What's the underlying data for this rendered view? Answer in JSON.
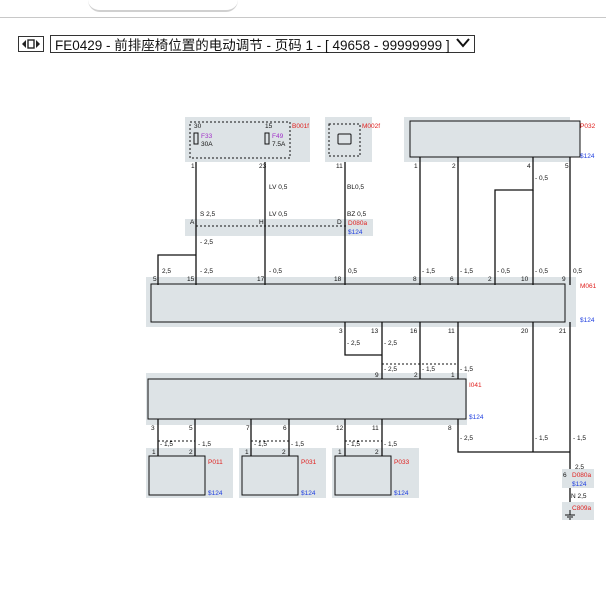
{
  "header": {
    "title": "FE0429 - 前排座椅位置的电动调节 - 页码 1 - [ 49658 - 99999999 ]",
    "icon": "fit-view-icon",
    "dropdown_icon": "chevron-down-icon"
  },
  "colors": {
    "box_fill": "#dde3e6",
    "component_red": "#e0201e",
    "signal_blue": "#1f3fe0",
    "fuse_purple": "#a030c8",
    "wire": "#111111"
  },
  "components": {
    "b001f": {
      "name": "B001f",
      "fuse1_pin": "30",
      "fuse1_id": "F33",
      "fuse1_rating": "30A",
      "fuse2_pin": "15",
      "fuse2_id": "F49",
      "fuse2_rating": "7.5A",
      "pin1": "1",
      "pin2": "23"
    },
    "m002f": {
      "name": "M002f",
      "pin": "11"
    },
    "p032": {
      "name": "P032",
      "ref": "$124",
      "pins": [
        "1",
        "2",
        "4",
        "5"
      ]
    },
    "d080a": {
      "name": "D080a",
      "ref": "$124",
      "pins": [
        "A",
        "H",
        "D"
      ]
    },
    "m061": {
      "name": "M061",
      "ref": "$124",
      "top_pins": [
        "5",
        "15",
        "17",
        "18",
        "8",
        "6",
        "2",
        "10",
        "9"
      ],
      "bottom_pins": [
        "3",
        "13",
        "16",
        "11",
        "20",
        "21"
      ]
    },
    "i041": {
      "name": "I041",
      "ref": "$124",
      "top_pins": [
        "9",
        "2",
        "1"
      ],
      "bottom_pins": [
        "3",
        "5",
        "7",
        "6",
        "12",
        "11",
        "8"
      ]
    },
    "p011": {
      "name": "P011",
      "ref": "$124",
      "pins": [
        "1",
        "2"
      ]
    },
    "p031": {
      "name": "P031",
      "ref": "$124",
      "pins": [
        "1",
        "2"
      ]
    },
    "p033": {
      "name": "P033",
      "ref": "$124",
      "pins": [
        "1",
        "2"
      ]
    },
    "d080a_ground": {
      "name": "D080a",
      "ref": "$124",
      "pin": "6"
    },
    "c809a": {
      "name": "C809a"
    }
  },
  "wire_labels": {
    "b001f_w1": "S 2,5",
    "lv_top": "LV 0,5",
    "lv_bottom": "LV 0,5",
    "bl_top": "BL0,5",
    "bz": "BZ 0,5",
    "w_2_5": "- 2,5",
    "w_0_5": "- 0,5",
    "w_1_5": "- 1,5",
    "w_25": "2,5",
    "w_05": "0,5",
    "n_2_5": "N 2,5",
    "w_2_5_plain": "2,5"
  }
}
